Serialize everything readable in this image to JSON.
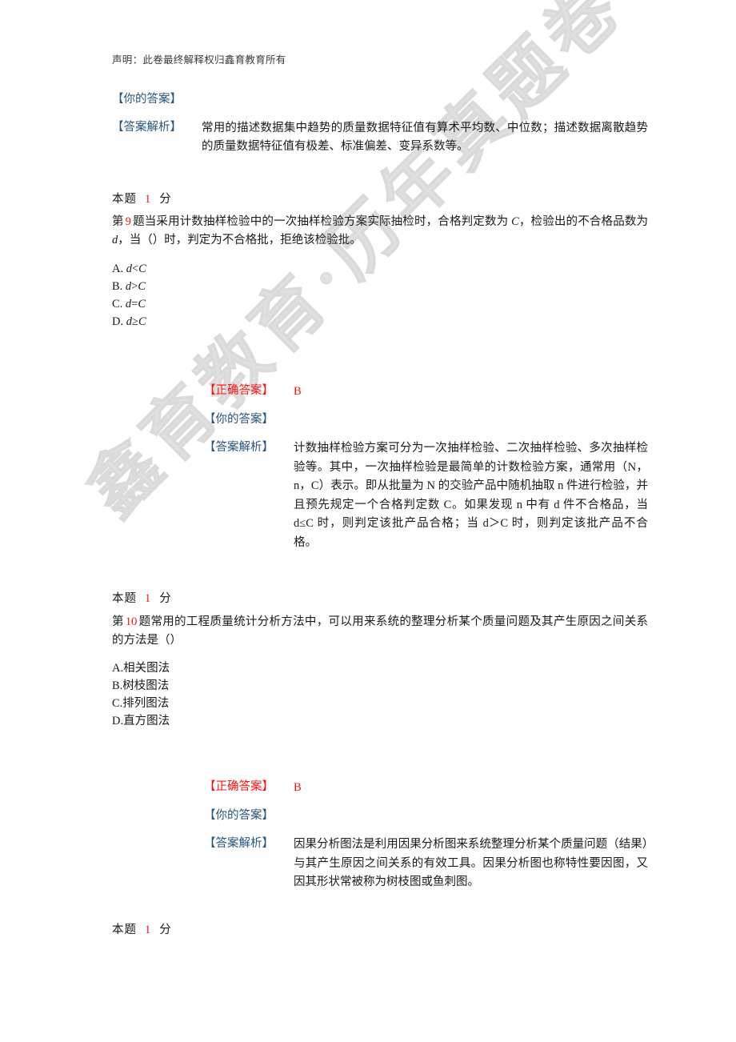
{
  "document": {
    "header_note": "声明：此卷最终解释权归鑫育教育所有",
    "watermark": "鑫育教育·历年真题卷",
    "colors": {
      "correct_answer_label": "#ff1111",
      "your_answer_label": "#26557f",
      "explanation_label": "#26557f",
      "score_number": "#ff1111",
      "question_number": "#ff1111",
      "watermark": "#c8c8c8"
    },
    "labels": {
      "correct_answer": "【正确答案】",
      "your_answer": "【你的答案】",
      "explanation": "【答案解析】",
      "score_prefix": "本题",
      "score_suffix": "分",
      "question_prefix": "第",
      "question_suffix": "题"
    }
  },
  "previous_question": {
    "your_answer_value": "",
    "explanation": "常用的描述数据集中趋势的质量数据特征值有算术平均数、中位数；描述数据离散趋势的质量数据特征值有极差、标准偏差、变异系数等。",
    "score_value": "1"
  },
  "questions": [
    {
      "number": "9",
      "stem_part1": "当采用计数抽样检验中的一次抽样检验方案实际抽检时，合格判定数为 ",
      "stem_math1": "C",
      "stem_part2": "，检验出的不合格品数为 ",
      "stem_math2": "d",
      "stem_part3": "，当（）时，判定为不合格批，拒绝该检验批。",
      "options": [
        {
          "key": "A.",
          "expr_left": "d",
          "op": "<",
          "expr_right": "C"
        },
        {
          "key": "B.",
          "expr_left": "d",
          "op": ">",
          "expr_right": "C"
        },
        {
          "key": "C.",
          "expr_left": "d",
          "op": "=",
          "expr_right": "C"
        },
        {
          "key": "D.",
          "expr_left": "d",
          "op": "≥",
          "expr_right": "C"
        }
      ],
      "correct_answer": "B",
      "your_answer_value": "",
      "explanation": "计数抽样检验方案可分为一次抽样检验、二次抽样检验、多次抽样检验等。其中，一次抽样检验是最简单的计数检验方案，通常用（N，n，C）表示。即从批量为 N 的交验产品中随机抽取 n 件进行检验，并且预先规定一个合格判定数 C。如果发现 n 中有 d 件不合格品，当 d≤C 时，则判定该批产品合格；当 d＞C 时，则判定该批产品不合格。",
      "score_value": "1"
    },
    {
      "number": "10",
      "stem_part1": "常用的工程质量统计分析方法中，可以用来系统的整理分析某个质量问题及其产生原因之间关系的方法是（）",
      "stem_math1": "",
      "stem_part2": "",
      "stem_math2": "",
      "stem_part3": "",
      "options": [
        {
          "key": "A.",
          "expr_left": "相关图法",
          "op": "",
          "expr_right": ""
        },
        {
          "key": "B.",
          "expr_left": "树枝图法",
          "op": "",
          "expr_right": ""
        },
        {
          "key": "C.",
          "expr_left": "排列图法",
          "op": "",
          "expr_right": ""
        },
        {
          "key": "D.",
          "expr_left": "直方图法",
          "op": "",
          "expr_right": ""
        }
      ],
      "correct_answer": "B",
      "your_answer_value": "",
      "explanation": "因果分析图法是利用因果分析图来系统整理分析某个质量问题（结果）与其产生原因之间关系的有效工具。因果分析图也称特性要因图，又因其形状常被称为树枝图或鱼刺图。",
      "score_value": "1"
    }
  ]
}
